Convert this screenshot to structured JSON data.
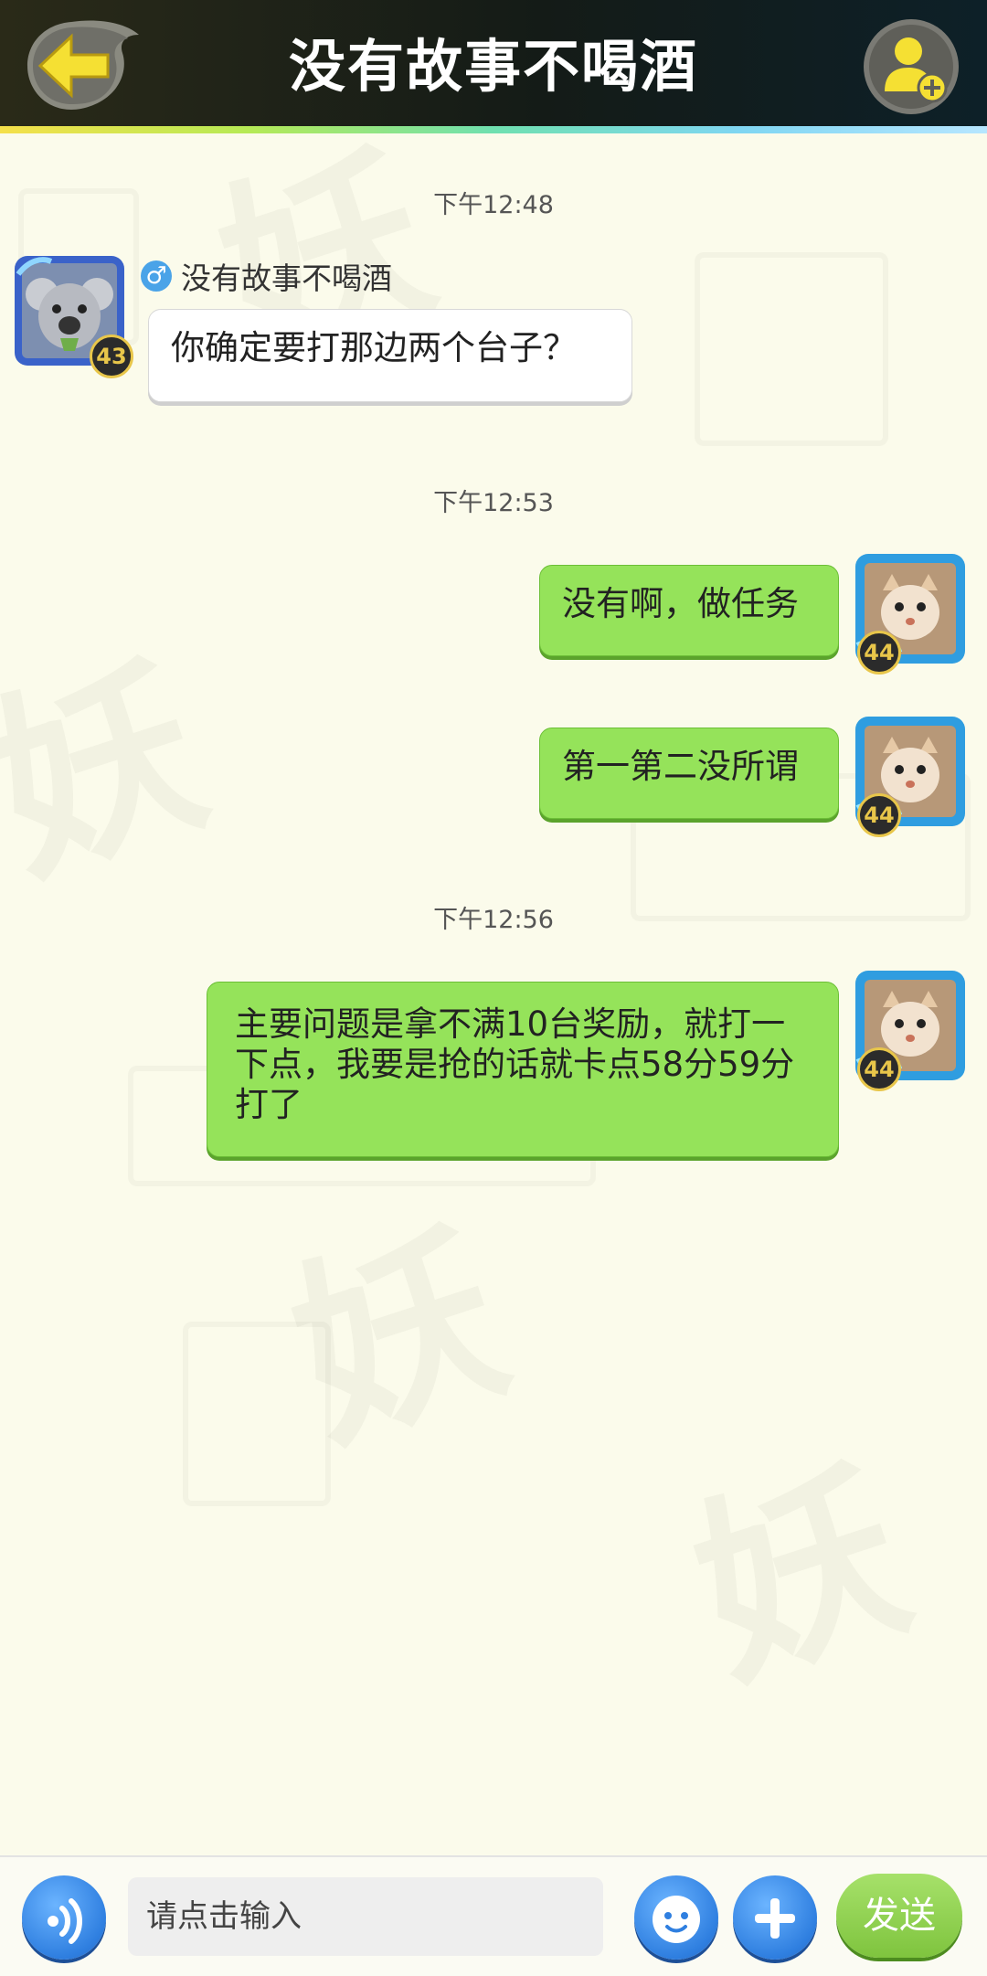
{
  "header": {
    "title": "没有故事不喝酒",
    "back_icon": "back-arrow-icon",
    "add_friend_icon": "add-friend-icon"
  },
  "messages": [
    {
      "timestamp": "下午12:48"
    },
    {
      "side": "left",
      "sender": "没有故事不喝酒",
      "gender": "♂",
      "level": "43",
      "text": "你确定要打那边两个台子？"
    },
    {
      "timestamp": "下午12:53"
    },
    {
      "side": "right",
      "level": "44",
      "text": "没有啊，做任务"
    },
    {
      "side": "right",
      "level": "44",
      "text": "第一第二没所谓"
    },
    {
      "timestamp": "下午12:56"
    },
    {
      "side": "right",
      "level": "44",
      "text": "主要问题是拿不满10台奖励，就打一下点，我要是抢的话就卡点58分59分打了"
    }
  ],
  "input": {
    "placeholder": "请点击输入"
  },
  "buttons": {
    "voice_icon": "voice-icon",
    "emoji_icon": "emoji-icon",
    "plus_icon": "plus-icon",
    "send_label": "发送"
  },
  "colors": {
    "accent_yellow": "#f5e033",
    "bubble_green": "#95e35a",
    "button_blue": "#2f7fe0",
    "send_green": "#7fc43e"
  }
}
